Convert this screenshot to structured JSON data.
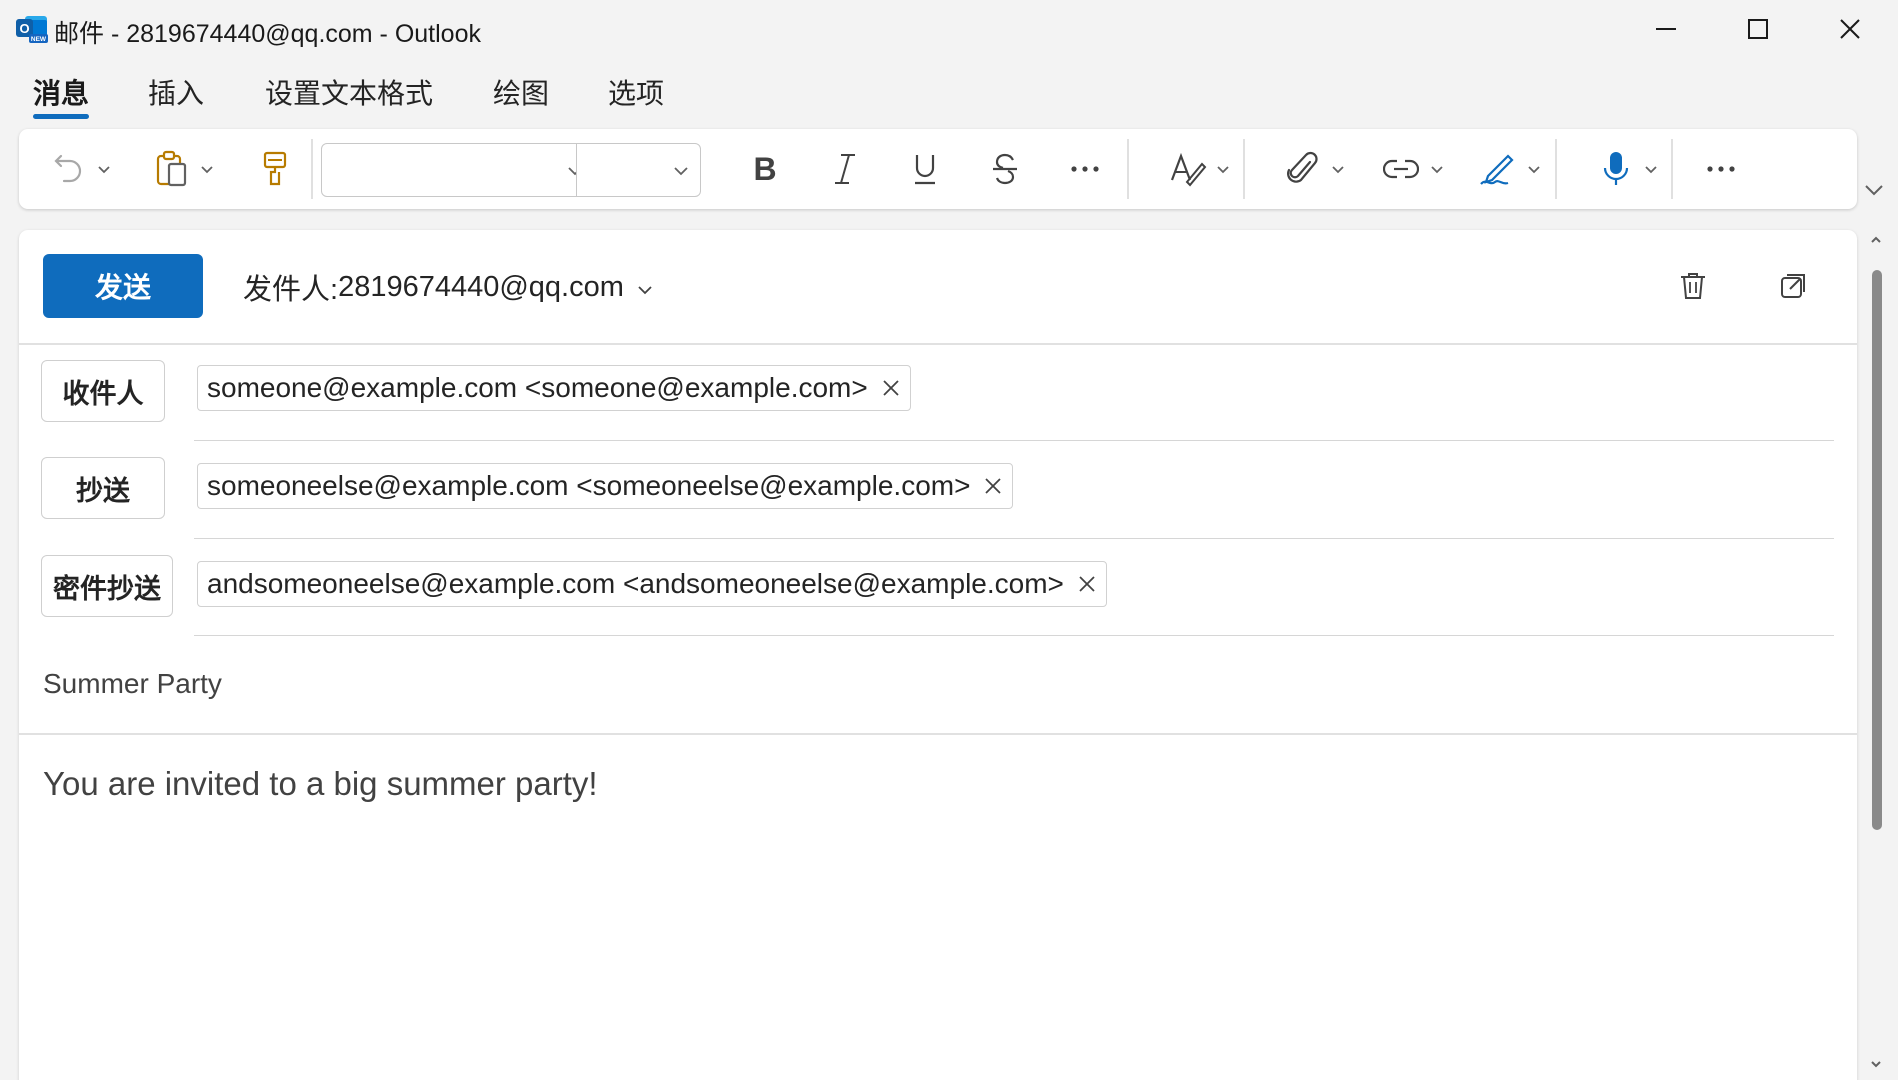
{
  "window": {
    "title": "邮件 - 2819674440@qq.com - Outlook",
    "app_icon": "outlook-new-icon",
    "controls": [
      "minimize-icon",
      "maximize-icon",
      "close-icon"
    ]
  },
  "ribbon": {
    "tabs": [
      {
        "label": "消息",
        "active": true
      },
      {
        "label": "插入",
        "active": false
      },
      {
        "label": "设置文本格式",
        "active": false
      },
      {
        "label": "绘图",
        "active": false
      },
      {
        "label": "选项",
        "active": false
      }
    ],
    "toolbar": {
      "font_name": "",
      "font_size": "",
      "icons": [
        "undo-icon",
        "paste-icon",
        "format-painter-icon",
        "bold-icon",
        "italic-icon",
        "underline-icon",
        "strikethrough-icon",
        "more-icon",
        "styles-icon",
        "attach-icon",
        "link-icon",
        "signature-icon",
        "dictate-icon",
        "overflow-icon"
      ]
    }
  },
  "compose": {
    "send_label": "发送",
    "from_label": "发件人:",
    "from_address": "2819674440@qq.com",
    "to_label": "收件人",
    "to_recipient": "someone@example.com <someone@example.com>",
    "cc_label": "抄送",
    "cc_recipient": "someoneelse@example.com <someoneelse@example.com>",
    "bcc_label": "密件抄送",
    "bcc_recipient": "andsomeoneelse@example.com <andsomeoneelse@example.com>",
    "subject": "Summer Party",
    "body": "You are invited to a big summer party!"
  },
  "colors": {
    "accent": "#0f6cbd",
    "background": "#f3f3f3",
    "card": "#ffffff"
  }
}
